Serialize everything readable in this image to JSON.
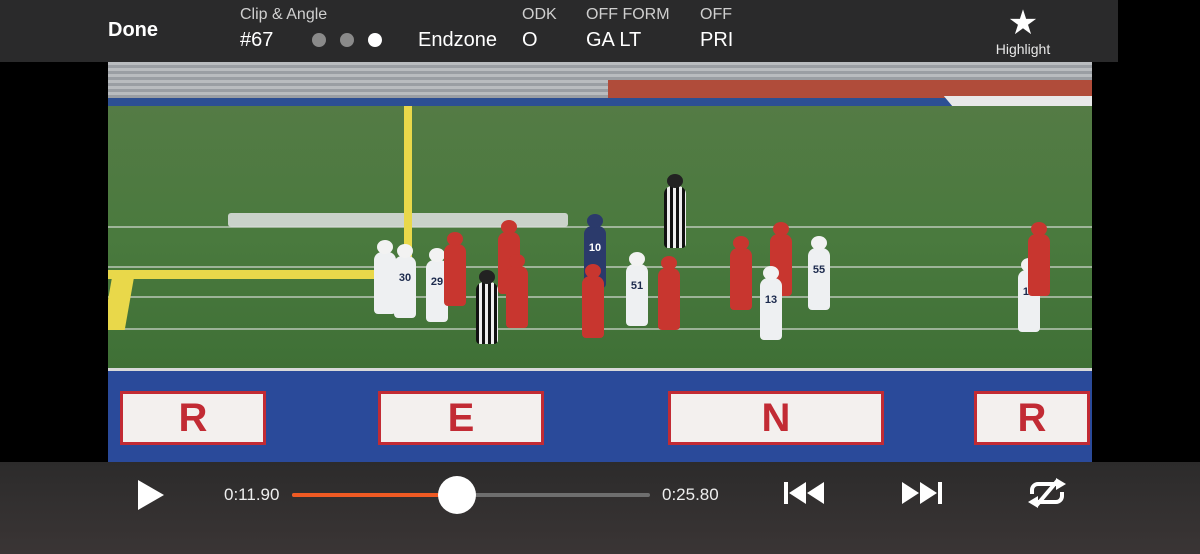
{
  "header": {
    "done_label": "Done",
    "clip_angle_label": "Clip & Angle",
    "clip_number": "#67",
    "angle_value": "Endzone",
    "odk_label": "ODK",
    "odk_value": "O",
    "off_form_label": "OFF FORM",
    "off_form_value": "GA LT",
    "off_play_label_partial": "OFF",
    "off_play_value_partial": "PRI",
    "angle_dots": {
      "count": 3,
      "active_index": 2
    },
    "highlight_label": "Highlight",
    "highlight_icon": "star-icon"
  },
  "video": {
    "endzone_letters": [
      "R",
      "E",
      "N",
      "R"
    ],
    "jersey_numbers": [
      "30",
      "29",
      "10",
      "51",
      "55",
      "13",
      "16"
    ]
  },
  "player_controls": {
    "play_icon": "play-icon",
    "current_time": "0:11.90",
    "end_time": "0:25.80",
    "progress_fraction": 0.46,
    "accent_color": "#ef5a23",
    "previous_icon": "skip-previous-icon",
    "next_icon": "skip-next-icon",
    "loop_icon": "loop-off-icon"
  }
}
